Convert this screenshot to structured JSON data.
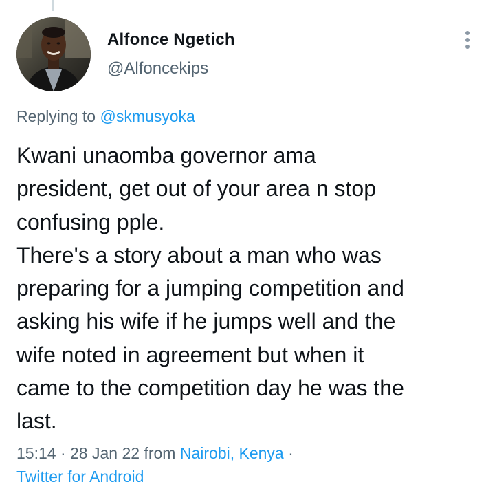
{
  "tweet": {
    "author": {
      "display_name": "Alfonce Ngetich",
      "handle": "@Alfoncekips"
    },
    "reply_prefix": "Replying to",
    "reply_to": "@skmusyoka",
    "text": "Kwani unaomba governor ama\npresident, get out of your area n stop\nconfusing pple.\nThere's a story about a man who was\npreparing for a jumping competition and\nasking his wife if he jumps well and the\nwife noted in agreement but when it\ncame to the competition day he was the\nlast.",
    "time": "15:14",
    "separator": "·",
    "date": "28 Jan 22",
    "from_label": "from",
    "location": "Nairobi, Kenya",
    "client": "Twitter for Android"
  },
  "icons": {
    "more": "more-vertical-icon",
    "avatar": "profile-photo"
  },
  "colors": {
    "link": "#1d9bf0",
    "secondary_text": "#536471",
    "primary_text": "#0f1419"
  }
}
